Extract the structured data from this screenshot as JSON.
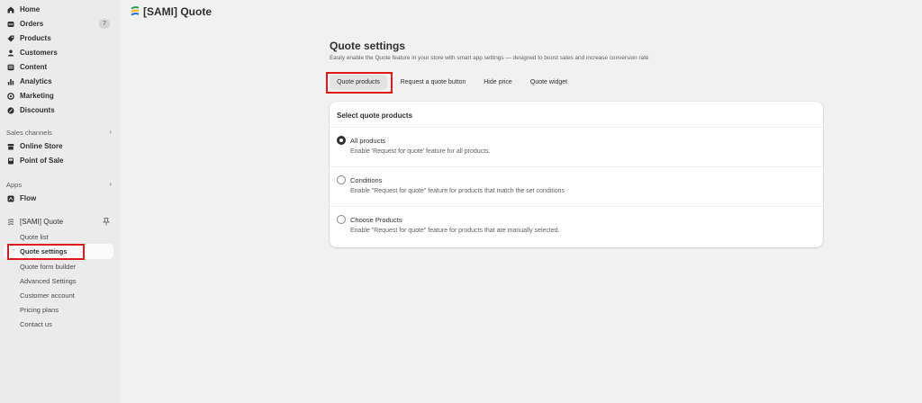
{
  "sidebar": {
    "nav": [
      {
        "label": "Home",
        "icon": "home-icon"
      },
      {
        "label": "Orders",
        "icon": "orders-icon",
        "badge": "7"
      },
      {
        "label": "Products",
        "icon": "tag-icon"
      },
      {
        "label": "Customers",
        "icon": "person-icon"
      },
      {
        "label": "Content",
        "icon": "content-icon"
      },
      {
        "label": "Analytics",
        "icon": "bar-chart-icon"
      },
      {
        "label": "Marketing",
        "icon": "target-icon"
      },
      {
        "label": "Discounts",
        "icon": "discount-icon"
      }
    ],
    "sales_channels_label": "Sales channels",
    "channels": [
      {
        "label": "Online Store",
        "icon": "store-icon"
      },
      {
        "label": "Point of Sale",
        "icon": "pos-icon"
      }
    ],
    "apps_label": "Apps",
    "apps": [
      {
        "label": "Flow",
        "icon": "flow-icon"
      }
    ],
    "app": {
      "label": "[SAMI] Quote",
      "items": [
        "Quote list",
        "Quote settings",
        "Quote form builder",
        "Advanced Settings",
        "Customer account",
        "Pricing plans",
        "Contact us"
      ]
    }
  },
  "header": {
    "title": "[SAMI] Quote"
  },
  "page": {
    "title": "Quote settings",
    "subtitle": "Easily enable the Quote feature in your store with smart app settings — designed to boost sales and increase conversion rate",
    "tabs": [
      "Quote products",
      "Request a quote button",
      "Hide price",
      "Quote widget"
    ]
  },
  "card": {
    "title": "Select quote products",
    "options": [
      {
        "label": "All products",
        "desc": "Enable 'Request for quote' feature for all products.",
        "checked": true
      },
      {
        "label": "Conditions",
        "desc": "Enable \"Request for quote\" feature for products that match the set conditions",
        "checked": false
      },
      {
        "label": "Choose Products",
        "desc": "Enable \"Request for quote\" feature for products that are manually selected.",
        "checked": false
      }
    ]
  },
  "colors": {
    "highlight": "#e11a1a",
    "background": "#f1f1f1",
    "sidebar": "#ebebeb"
  }
}
